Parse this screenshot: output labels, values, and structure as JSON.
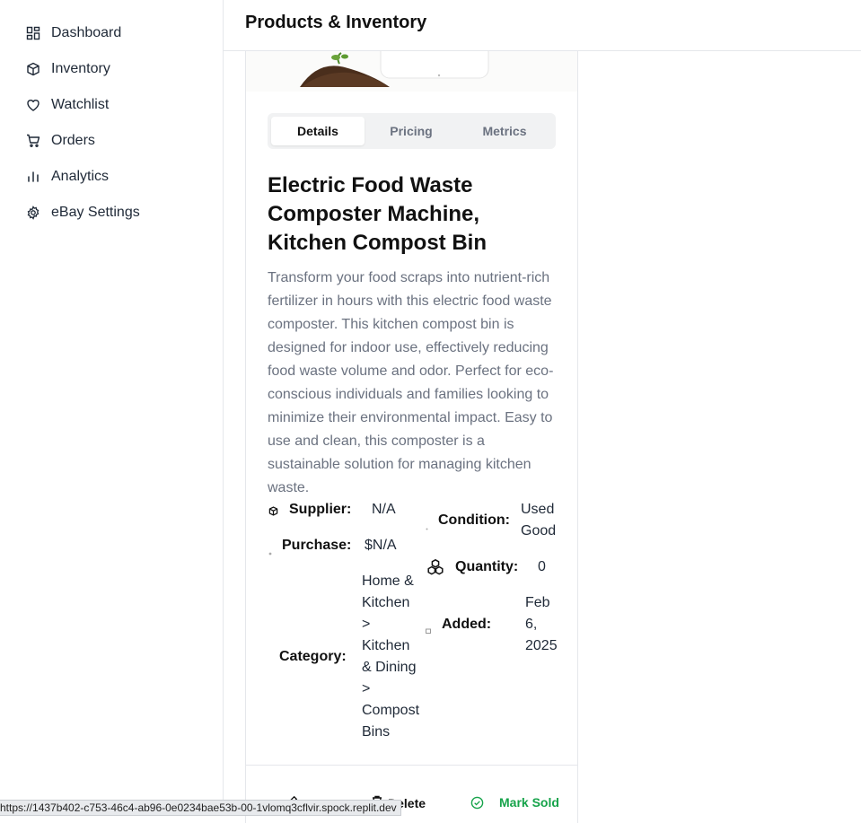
{
  "sidebar": {
    "items": [
      {
        "label": "Dashboard",
        "icon": "dashboard-icon"
      },
      {
        "label": "Inventory",
        "icon": "package-icon"
      },
      {
        "label": "Watchlist",
        "icon": "heart-icon"
      },
      {
        "label": "Orders",
        "icon": "cart-icon"
      },
      {
        "label": "Analytics",
        "icon": "bar-chart-icon"
      },
      {
        "label": "eBay Settings",
        "icon": "gear-icon"
      }
    ]
  },
  "header": {
    "title": "Products & Inventory"
  },
  "product": {
    "tabs": [
      "Details",
      "Pricing",
      "Metrics"
    ],
    "active_tab": "Details",
    "title": "Electric Food Waste Composter Machine, Kitchen Compost Bin",
    "description": "Transform your food scraps into nutrient-rich fertilizer in hours with this electric food waste composter. This kitchen compost bin is designed for indoor use, effectively reducing food waste volume and odor. Perfect for eco-conscious individuals and families looking to minimize their environmental impact. Easy to use and clean, this composter is a sustainable solution for managing kitchen waste.",
    "details": {
      "supplier_label": "Supplier:",
      "supplier_value": "N/A",
      "purchase_label": "Purchase:",
      "purchase_value": "$N/A",
      "category_label": "Category:",
      "category_value_lines": [
        "Home &",
        "Kitchen",
        ">",
        "Kitchen",
        "& Dining",
        ">",
        "Compost",
        "Bins"
      ],
      "condition_label": "Condition:",
      "condition_value_lines": [
        "Used",
        "Good"
      ],
      "quantity_label": "Quantity:",
      "quantity_value": "0",
      "added_label": "Added:",
      "added_value_lines": [
        "Feb",
        "6,",
        "2025"
      ]
    },
    "actions": {
      "delete_label": "Delete",
      "mark_sold_label": "Mark Sold"
    }
  },
  "colors": {
    "accent_green": "#16a34a",
    "muted_text": "#6b7280"
  },
  "status_bar": {
    "url": "https://1437b402-c753-46c4-ab96-0e0234bae53b-00-1vlomq3cflvir.spock.replit.dev"
  }
}
